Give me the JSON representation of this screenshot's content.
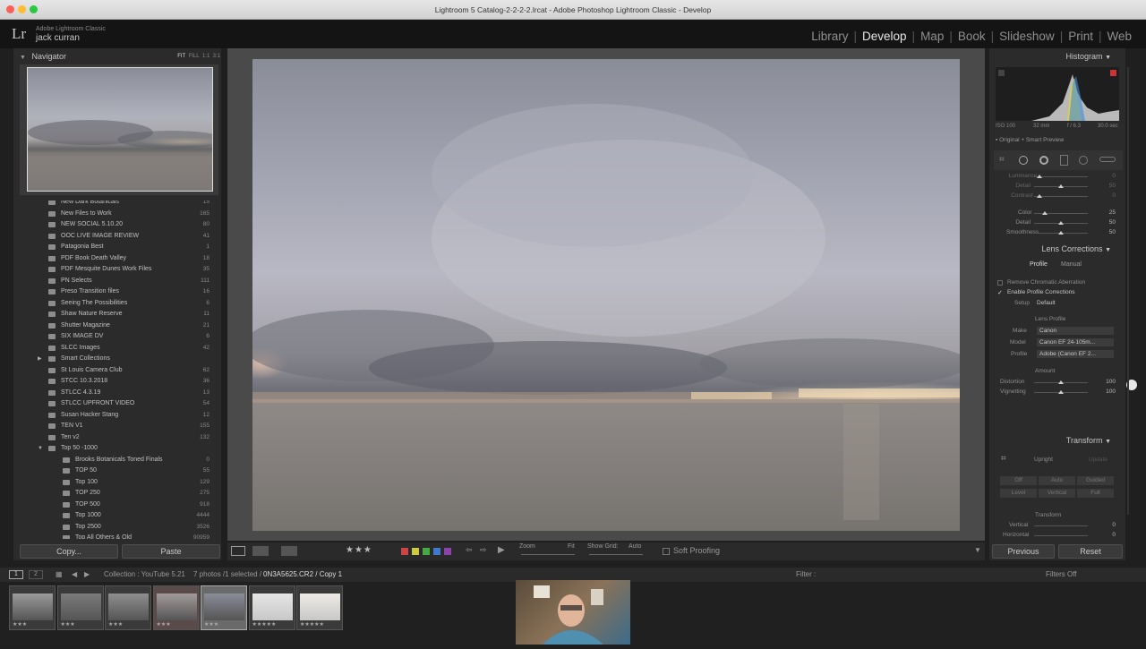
{
  "window": {
    "title": "Lightroom 5 Catalog-2-2-2-2.lrcat - Adobe Photoshop Lightroom Classic - Develop"
  },
  "identity": {
    "logo": "Lr",
    "app": "Adobe Lightroom Classic",
    "user": "jack curran"
  },
  "modules": [
    "Library",
    "Develop",
    "Map",
    "Book",
    "Slideshow",
    "Print",
    "Web"
  ],
  "active_module": "Develop",
  "navigator": {
    "title": "Navigator",
    "zoom_options": [
      "FIT",
      "FILL",
      "1:1",
      "3:1"
    ]
  },
  "folders": [
    {
      "name": "New Dark Botanicals",
      "count": "15"
    },
    {
      "name": "New Files to Work",
      "count": "165"
    },
    {
      "name": "NEW SOCIAL 5.10.20",
      "count": "80"
    },
    {
      "name": "OOC LIVE IMAGE REVIEW",
      "count": "41"
    },
    {
      "name": "Patagonia Best",
      "count": "1"
    },
    {
      "name": "PDF Book Death Valley",
      "count": "18"
    },
    {
      "name": "PDF Mesquite Dunes Work Files",
      "count": "35"
    },
    {
      "name": "PN Selects",
      "count": "111"
    },
    {
      "name": "Preso Transition files",
      "count": "16"
    },
    {
      "name": "Seeing The Possibilities",
      "count": "6"
    },
    {
      "name": "Shaw Nature Reserve",
      "count": "11"
    },
    {
      "name": "Shutter Magazine",
      "count": "21"
    },
    {
      "name": "SIX IMAGE DV",
      "count": "6"
    },
    {
      "name": "SLCC Images",
      "count": "42"
    },
    {
      "name": "Smart Collections",
      "count": ""
    },
    {
      "name": "St Louis Camera Club",
      "count": "62"
    },
    {
      "name": "STCC 10.3.2018",
      "count": "36"
    },
    {
      "name": "STLCC 4.3.19",
      "count": "13"
    },
    {
      "name": "STLCC UPFRONT VIDEO",
      "count": "54"
    },
    {
      "name": "Susan Hacker Stang",
      "count": "12"
    },
    {
      "name": "TEN V1",
      "count": "155"
    },
    {
      "name": "Ten v2",
      "count": "132"
    },
    {
      "name": "Top 50 -1000",
      "count": ""
    },
    {
      "name": "Brooks Botanicals Toned Finals",
      "count": "0"
    },
    {
      "name": "TOP 50",
      "count": "55"
    },
    {
      "name": "Top 100",
      "count": "129"
    },
    {
      "name": "TOP 250",
      "count": "275"
    },
    {
      "name": "TOP 500",
      "count": "918"
    },
    {
      "name": "Top 1000",
      "count": "4444"
    },
    {
      "name": "Top 2500",
      "count": "3526"
    },
    {
      "name": "Top All Others & Old",
      "count": "90959"
    }
  ],
  "left_buttons": {
    "copy": "Copy...",
    "paste": "Paste"
  },
  "histogram": {
    "title": "Histogram",
    "iso": "ISO 100",
    "focal": "32 mm",
    "aperture": "f / 6.3",
    "shutter": "30.0 sec",
    "preview": "Original + Smart Preview"
  },
  "detail": {
    "labels": [
      "Luminance",
      "Detail",
      "Contrast",
      "Color",
      "Detail",
      "Smoothness"
    ],
    "values": [
      "0",
      "50",
      "0",
      "25",
      "50",
      "50"
    ]
  },
  "lens": {
    "title": "Lens Corrections",
    "tabs": [
      "Profile",
      "Manual"
    ],
    "remove_ca": "Remove Chromatic Aberration",
    "enable_profile": "Enable Profile Corrections",
    "setup_label": "Setup",
    "setup_value": "Default",
    "lens_profile": "Lens Profile",
    "make_label": "Make",
    "make_value": "Canon",
    "model_label": "Model",
    "model_value": "Canon EF 24-105m...",
    "profile_label": "Profile",
    "profile_value": "Adobe (Canon EF 2...",
    "amount": "Amount",
    "distortion_label": "Distortion",
    "distortion_value": "100",
    "vignetting_label": "Vignetting",
    "vignetting_value": "100"
  },
  "transform": {
    "title": "Transform",
    "upright": "Upright",
    "update": "Update",
    "buttons": [
      "Off",
      "Auto",
      "Guided",
      "Level",
      "Vertical",
      "Full"
    ],
    "sub": "Transform",
    "vertical_label": "Vertical",
    "vertical_value": "0",
    "horizontal_label": "Horizontal",
    "horizontal_value": "0"
  },
  "right_buttons": {
    "previous": "Previous",
    "reset": "Reset"
  },
  "toolbar": {
    "zoom": "Zoom",
    "fit": "Fit",
    "show_grid": "Show Grid:",
    "grid_value": "Auto",
    "soft_proofing": "Soft Proofing"
  },
  "filmstrip": {
    "pages": [
      "1",
      "2"
    ],
    "collection": "Collection : YouTube 5.21",
    "selection": "7 photos /1 selected /",
    "filename": "0N3A5625.CR2 / Copy 1",
    "filter_label": "Filter :",
    "filter_value": "Filters Off"
  },
  "thumbnails": [
    {
      "stars": "★★★"
    },
    {
      "stars": "★★★"
    },
    {
      "stars": "★★★"
    },
    {
      "stars": "★★★"
    },
    {
      "stars": "★★★"
    },
    {
      "stars": "★★★★★"
    },
    {
      "stars": "★★★★★"
    }
  ]
}
